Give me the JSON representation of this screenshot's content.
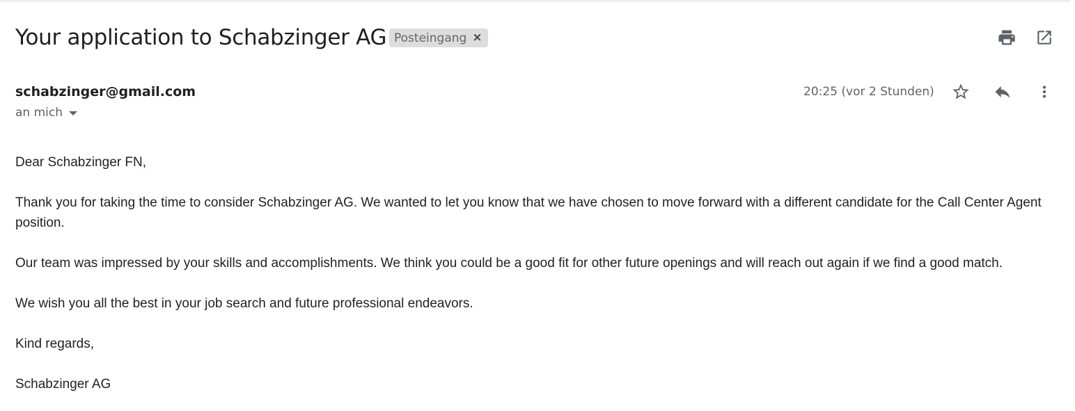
{
  "email": {
    "subject": "Your application to Schabzinger AG",
    "label": "Posteingang",
    "label_close": "×",
    "sender": "schabzinger@gmail.com",
    "recipient": "an mich",
    "timestamp": "20:25 (vor 2 Stunden)",
    "body": [
      "Dear Schabzinger FN,",
      "Thank you for taking the time to consider Schabzinger AG. We wanted to let you know that we have chosen to move forward with a different candidate for the Call Center Agent position.",
      "Our team was impressed by your skills and accomplishments. We think you could be a good fit for other future openings and will reach out again if we find a good match.",
      "We wish you all the best in your job search and future professional endeavors.",
      "Kind regards,",
      "Schabzinger AG"
    ]
  },
  "icons": {
    "print": "print-icon",
    "open_new_window": "open-in-new-window-icon",
    "star": "star-icon",
    "reply": "reply-icon",
    "more": "more-vertical-icon"
  },
  "colors": {
    "text": "#222222",
    "secondary_text": "#5f6368",
    "chip_bg": "#dddddd",
    "icon": "#5f6368"
  }
}
